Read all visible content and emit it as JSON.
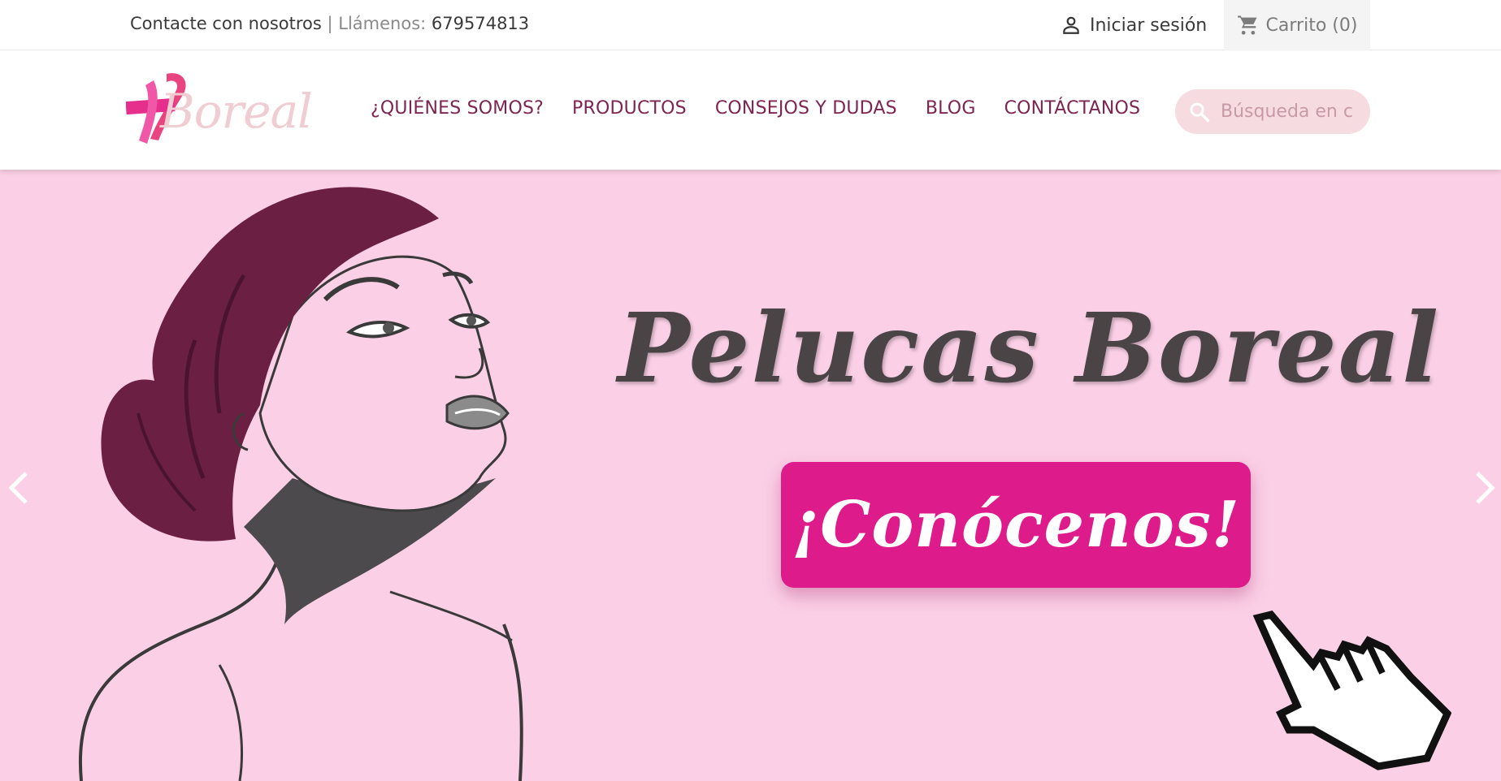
{
  "topbar": {
    "contact_text": "Contacte con nosotros",
    "separator": " | ",
    "call_label": "Llámenos: ",
    "phone": "679574813",
    "login_label": "Iniciar sesión",
    "login_icon": "user-icon",
    "cart_label": "Carrito (0)",
    "cart_icon": "cart-icon"
  },
  "header": {
    "logo_text": "Boreal",
    "nav": [
      {
        "label": "¿QUIÉNES SOMOS?"
      },
      {
        "label": "PRODUCTOS"
      },
      {
        "label": "CONSEJOS Y DUDAS"
      },
      {
        "label": "BLOG"
      },
      {
        "label": "CONTÁCTANOS"
      }
    ],
    "search_placeholder": "Búsqueda en c",
    "search_icon": "search-icon"
  },
  "hero": {
    "title": "Pelucas Boreal",
    "cta_label": "¡Conócenos!",
    "prev_icon": "chevron-left-icon",
    "next_icon": "chevron-right-icon"
  },
  "colors": {
    "brand": "#7d2451",
    "accent": "#de1b8a",
    "hero_bg": "#fbd0e6",
    "search_bg": "#f6dbe1"
  }
}
